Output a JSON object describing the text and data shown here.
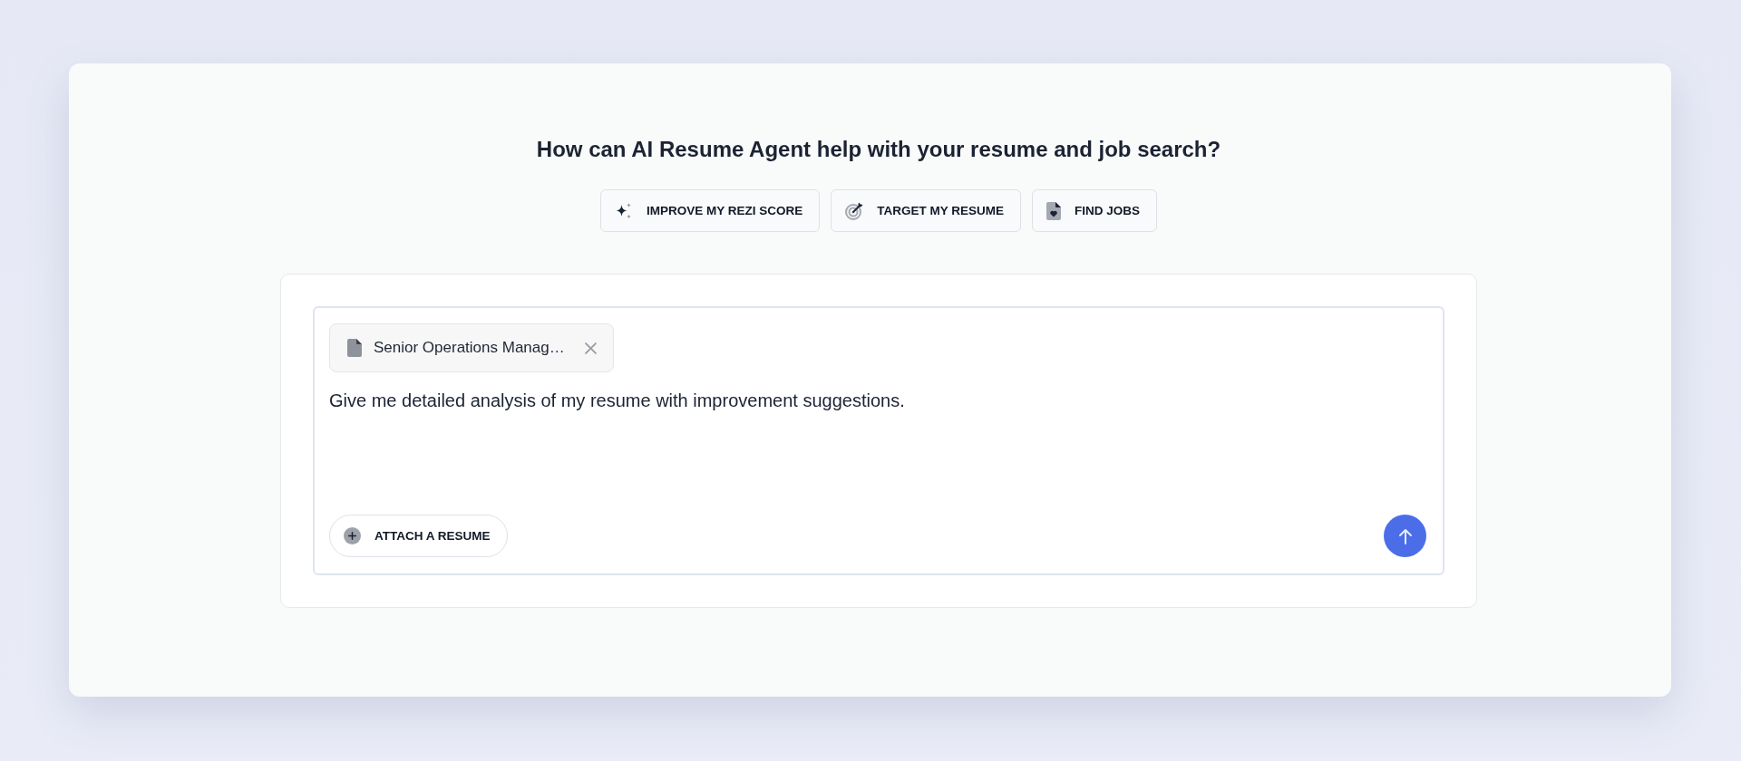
{
  "heading": "How can AI Resume Agent help with your resume and job search?",
  "quick_actions": [
    {
      "kind": "score",
      "label": "IMPROVE MY REZI SCORE"
    },
    {
      "kind": "target",
      "label": "TARGET MY RESUME"
    },
    {
      "kind": "jobs",
      "label": "FIND JOBS"
    }
  ],
  "composer": {
    "attachment": {
      "name": "Senior Operations Manag…"
    },
    "message": "Give me detailed analysis of my resume with improvement suggestions.",
    "attach_button": "ATTACH A RESUME"
  }
}
